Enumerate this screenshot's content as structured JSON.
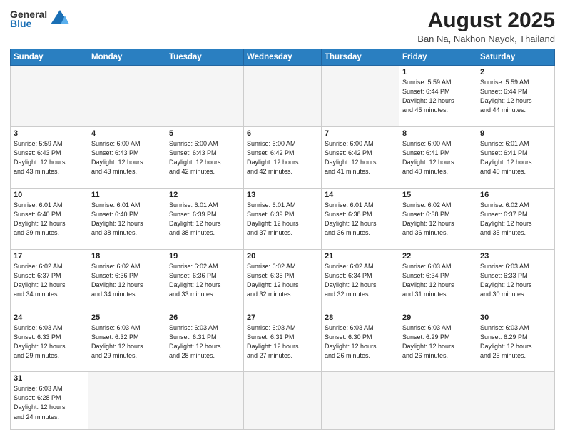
{
  "header": {
    "logo_general": "General",
    "logo_blue": "Blue",
    "month_title": "August 2025",
    "location": "Ban Na, Nakhon Nayok, Thailand"
  },
  "days_of_week": [
    "Sunday",
    "Monday",
    "Tuesday",
    "Wednesday",
    "Thursday",
    "Friday",
    "Saturday"
  ],
  "weeks": [
    [
      {
        "day": "",
        "info": ""
      },
      {
        "day": "",
        "info": ""
      },
      {
        "day": "",
        "info": ""
      },
      {
        "day": "",
        "info": ""
      },
      {
        "day": "",
        "info": ""
      },
      {
        "day": "1",
        "info": "Sunrise: 5:59 AM\nSunset: 6:44 PM\nDaylight: 12 hours\nand 45 minutes."
      },
      {
        "day": "2",
        "info": "Sunrise: 5:59 AM\nSunset: 6:44 PM\nDaylight: 12 hours\nand 44 minutes."
      }
    ],
    [
      {
        "day": "3",
        "info": "Sunrise: 5:59 AM\nSunset: 6:43 PM\nDaylight: 12 hours\nand 43 minutes."
      },
      {
        "day": "4",
        "info": "Sunrise: 6:00 AM\nSunset: 6:43 PM\nDaylight: 12 hours\nand 43 minutes."
      },
      {
        "day": "5",
        "info": "Sunrise: 6:00 AM\nSunset: 6:43 PM\nDaylight: 12 hours\nand 42 minutes."
      },
      {
        "day": "6",
        "info": "Sunrise: 6:00 AM\nSunset: 6:42 PM\nDaylight: 12 hours\nand 42 minutes."
      },
      {
        "day": "7",
        "info": "Sunrise: 6:00 AM\nSunset: 6:42 PM\nDaylight: 12 hours\nand 41 minutes."
      },
      {
        "day": "8",
        "info": "Sunrise: 6:00 AM\nSunset: 6:41 PM\nDaylight: 12 hours\nand 40 minutes."
      },
      {
        "day": "9",
        "info": "Sunrise: 6:01 AM\nSunset: 6:41 PM\nDaylight: 12 hours\nand 40 minutes."
      }
    ],
    [
      {
        "day": "10",
        "info": "Sunrise: 6:01 AM\nSunset: 6:40 PM\nDaylight: 12 hours\nand 39 minutes."
      },
      {
        "day": "11",
        "info": "Sunrise: 6:01 AM\nSunset: 6:40 PM\nDaylight: 12 hours\nand 38 minutes."
      },
      {
        "day": "12",
        "info": "Sunrise: 6:01 AM\nSunset: 6:39 PM\nDaylight: 12 hours\nand 38 minutes."
      },
      {
        "day": "13",
        "info": "Sunrise: 6:01 AM\nSunset: 6:39 PM\nDaylight: 12 hours\nand 37 minutes."
      },
      {
        "day": "14",
        "info": "Sunrise: 6:01 AM\nSunset: 6:38 PM\nDaylight: 12 hours\nand 36 minutes."
      },
      {
        "day": "15",
        "info": "Sunrise: 6:02 AM\nSunset: 6:38 PM\nDaylight: 12 hours\nand 36 minutes."
      },
      {
        "day": "16",
        "info": "Sunrise: 6:02 AM\nSunset: 6:37 PM\nDaylight: 12 hours\nand 35 minutes."
      }
    ],
    [
      {
        "day": "17",
        "info": "Sunrise: 6:02 AM\nSunset: 6:37 PM\nDaylight: 12 hours\nand 34 minutes."
      },
      {
        "day": "18",
        "info": "Sunrise: 6:02 AM\nSunset: 6:36 PM\nDaylight: 12 hours\nand 34 minutes."
      },
      {
        "day": "19",
        "info": "Sunrise: 6:02 AM\nSunset: 6:36 PM\nDaylight: 12 hours\nand 33 minutes."
      },
      {
        "day": "20",
        "info": "Sunrise: 6:02 AM\nSunset: 6:35 PM\nDaylight: 12 hours\nand 32 minutes."
      },
      {
        "day": "21",
        "info": "Sunrise: 6:02 AM\nSunset: 6:34 PM\nDaylight: 12 hours\nand 32 minutes."
      },
      {
        "day": "22",
        "info": "Sunrise: 6:03 AM\nSunset: 6:34 PM\nDaylight: 12 hours\nand 31 minutes."
      },
      {
        "day": "23",
        "info": "Sunrise: 6:03 AM\nSunset: 6:33 PM\nDaylight: 12 hours\nand 30 minutes."
      }
    ],
    [
      {
        "day": "24",
        "info": "Sunrise: 6:03 AM\nSunset: 6:33 PM\nDaylight: 12 hours\nand 29 minutes."
      },
      {
        "day": "25",
        "info": "Sunrise: 6:03 AM\nSunset: 6:32 PM\nDaylight: 12 hours\nand 29 minutes."
      },
      {
        "day": "26",
        "info": "Sunrise: 6:03 AM\nSunset: 6:31 PM\nDaylight: 12 hours\nand 28 minutes."
      },
      {
        "day": "27",
        "info": "Sunrise: 6:03 AM\nSunset: 6:31 PM\nDaylight: 12 hours\nand 27 minutes."
      },
      {
        "day": "28",
        "info": "Sunrise: 6:03 AM\nSunset: 6:30 PM\nDaylight: 12 hours\nand 26 minutes."
      },
      {
        "day": "29",
        "info": "Sunrise: 6:03 AM\nSunset: 6:29 PM\nDaylight: 12 hours\nand 26 minutes."
      },
      {
        "day": "30",
        "info": "Sunrise: 6:03 AM\nSunset: 6:29 PM\nDaylight: 12 hours\nand 25 minutes."
      }
    ],
    [
      {
        "day": "31",
        "info": "Sunrise: 6:03 AM\nSunset: 6:28 PM\nDaylight: 12 hours\nand 24 minutes."
      },
      {
        "day": "",
        "info": ""
      },
      {
        "day": "",
        "info": ""
      },
      {
        "day": "",
        "info": ""
      },
      {
        "day": "",
        "info": ""
      },
      {
        "day": "",
        "info": ""
      },
      {
        "day": "",
        "info": ""
      }
    ]
  ]
}
